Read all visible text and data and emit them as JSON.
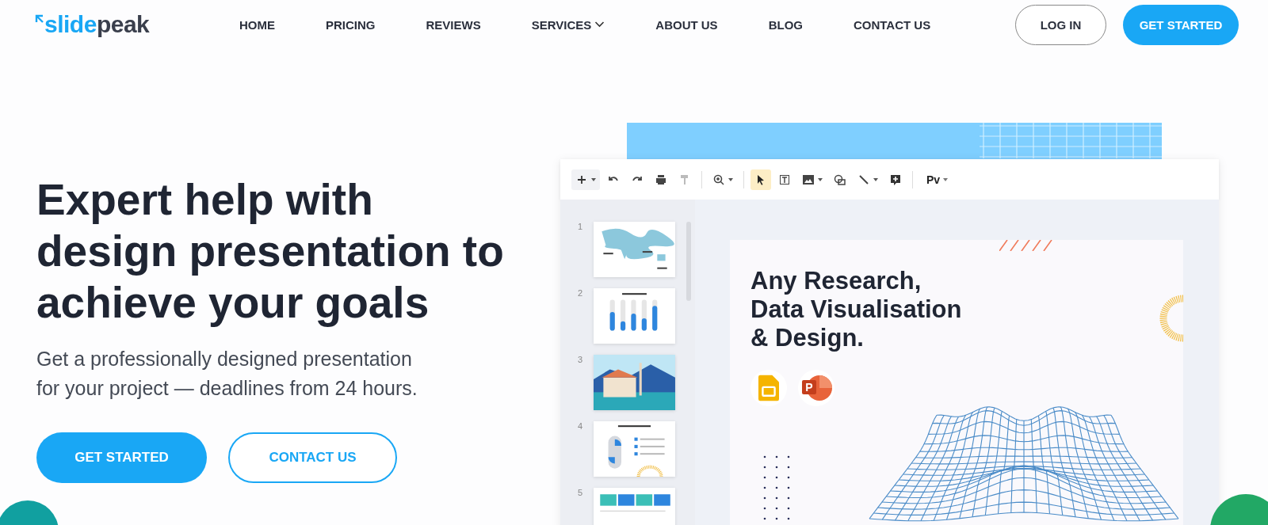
{
  "logo": {
    "text_a": "slide",
    "text_b": "peak"
  },
  "nav": [
    {
      "label": "HOME",
      "has_menu": false
    },
    {
      "label": "PRICING",
      "has_menu": false
    },
    {
      "label": "REVIEWS",
      "has_menu": false
    },
    {
      "label": "SERVICES",
      "has_menu": true
    },
    {
      "label": "ABOUT US",
      "has_menu": false
    },
    {
      "label": "BLOG",
      "has_menu": false
    },
    {
      "label": "CONTACT US",
      "has_menu": false
    }
  ],
  "header_buttons": [
    {
      "label": "LOG IN",
      "kind": "outline"
    },
    {
      "label": "GET STARTED",
      "kind": "filled"
    }
  ],
  "hero": {
    "title": "Expert help with\ndesign presentation to\nachieve your goals",
    "subtitle": "Get a professionally designed presentation\nfor your project — deadlines from 24 hours.",
    "buttons": [
      {
        "label": "GET STARTED",
        "kind": "filled"
      },
      {
        "label": "CONTACT US",
        "kind": "outline"
      }
    ]
  },
  "editor": {
    "tools": [
      {
        "kind": "add",
        "selected": false
      },
      {
        "kind": "undo",
        "selected": false
      },
      {
        "kind": "redo",
        "selected": false
      },
      {
        "kind": "print",
        "selected": false
      },
      {
        "kind": "paint",
        "selected": false
      },
      {
        "kind": "zoom",
        "selected": false
      },
      {
        "kind": "pointer",
        "selected": true
      },
      {
        "kind": "textbox",
        "selected": false
      },
      {
        "kind": "image",
        "selected": false
      },
      {
        "kind": "shape",
        "selected": false
      },
      {
        "kind": "line",
        "selected": false
      },
      {
        "kind": "comment",
        "selected": false
      }
    ],
    "font_label": "Pv",
    "thumbnails": [
      {
        "number": "1",
        "kind": "map",
        "selected": false
      },
      {
        "number": "2",
        "kind": "bars",
        "selected": false
      },
      {
        "number": "3",
        "kind": "landscape",
        "selected": false
      },
      {
        "number": "4",
        "kind": "pie",
        "selected": false
      },
      {
        "number": "5",
        "kind": "stats",
        "selected": false
      }
    ],
    "slide": {
      "heading": "Any Research,\nData Visualisation\n& Design.",
      "app_letter": "P"
    }
  }
}
